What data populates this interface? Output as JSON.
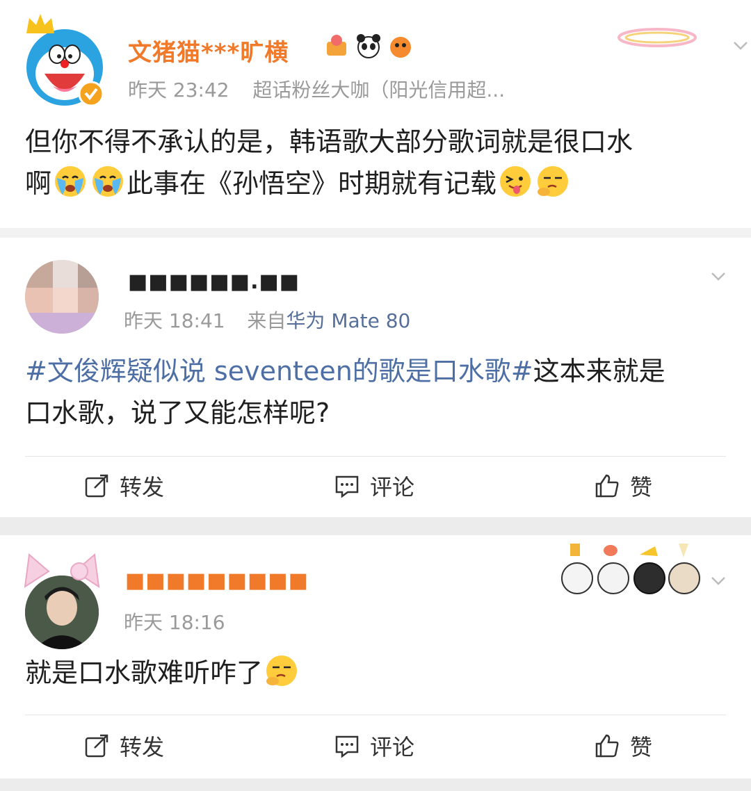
{
  "posts": [
    {
      "name": "文猪猫***旷横",
      "time": "昨天 23:42",
      "source": "超话粉丝大咖（阳光信用超...",
      "text_line1": "但你不得不承认的是，韩语歌大部分歌词就是很口水",
      "text_line2_a": "啊",
      "text_line2_b": "此事在《孙悟空》时期就有记载"
    },
    {
      "name": "■■■■■■.■■",
      "time": "昨天 18:41",
      "source_prefix": "来自",
      "source": "华为 Mate 80",
      "topic": "#文俊辉疑似说 seventeen的歌是口水歌#",
      "text_line1_rest": "这本来就是",
      "text_line2": "口水歌，说了又能怎样呢?",
      "actions": {
        "repost": "转发",
        "comment": "评论",
        "like": "赞"
      }
    },
    {
      "name": "■■■■■■■■■",
      "time": "昨天 18:16",
      "text": "就是口水歌难听咋了",
      "actions": {
        "repost": "转发",
        "comment": "评论",
        "like": "赞"
      }
    }
  ],
  "icons": {
    "avatar1": "doraemon-avatar-icon",
    "verified": "verified-badge-icon",
    "crying": "crying-emoji-icon",
    "tongue": "tongue-out-emoji-icon",
    "thinking": "thinking-emoji-icon",
    "chevron": "chevron-down-icon",
    "repost": "repost-icon",
    "comment": "comment-icon",
    "like": "like-icon"
  },
  "colors": {
    "accent": "#f07a2a",
    "link": "#4d6fa5",
    "meta": "#9a9a9a"
  }
}
